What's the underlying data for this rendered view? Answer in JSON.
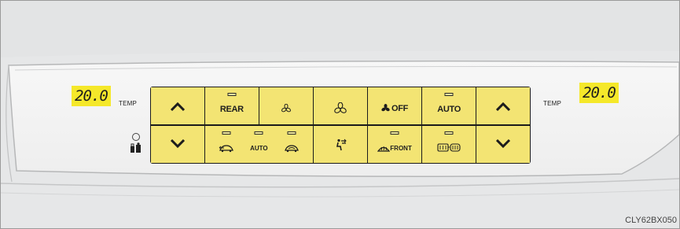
{
  "panel": {
    "left_temp": {
      "value": "20.0",
      "label": "TEMP"
    },
    "right_temp": {
      "value": "20.0",
      "label": "TEMP"
    },
    "top_row": [
      {
        "id": "temp-up-left",
        "icon": "chevron-up-icon"
      },
      {
        "id": "rear",
        "label": "REAR",
        "indicator": true
      },
      {
        "id": "fan-low",
        "icon": "fan-small-icon"
      },
      {
        "id": "fan-high",
        "icon": "fan-large-icon"
      },
      {
        "id": "fan-off",
        "label": "OFF",
        "icon": "fan-icon"
      },
      {
        "id": "auto",
        "label": "AUTO",
        "indicator": true
      },
      {
        "id": "temp-up-right",
        "icon": "chevron-up-icon"
      }
    ],
    "bottom_row": [
      {
        "id": "temp-down-left",
        "icon": "chevron-down-icon"
      },
      {
        "id": "air-intake",
        "label": "AUTO",
        "icons": [
          "outside-air-icon",
          "recirculate-air-icon"
        ],
        "indicator": true
      },
      {
        "id": "airflow-mode",
        "icon": "airflow-vent-icon"
      },
      {
        "id": "front-defog",
        "label": "FRONT",
        "icon": "front-defroster-icon",
        "indicator": true
      },
      {
        "id": "rear-defog",
        "icons": [
          "rear-defogger-icon",
          "mirror-defogger-icon"
        ],
        "indicator": true
      },
      {
        "id": "temp-down-right",
        "icon": "chevron-down-icon"
      }
    ],
    "side_icon": "passenger-sync-icon"
  },
  "image_code": "CLY62BX050"
}
